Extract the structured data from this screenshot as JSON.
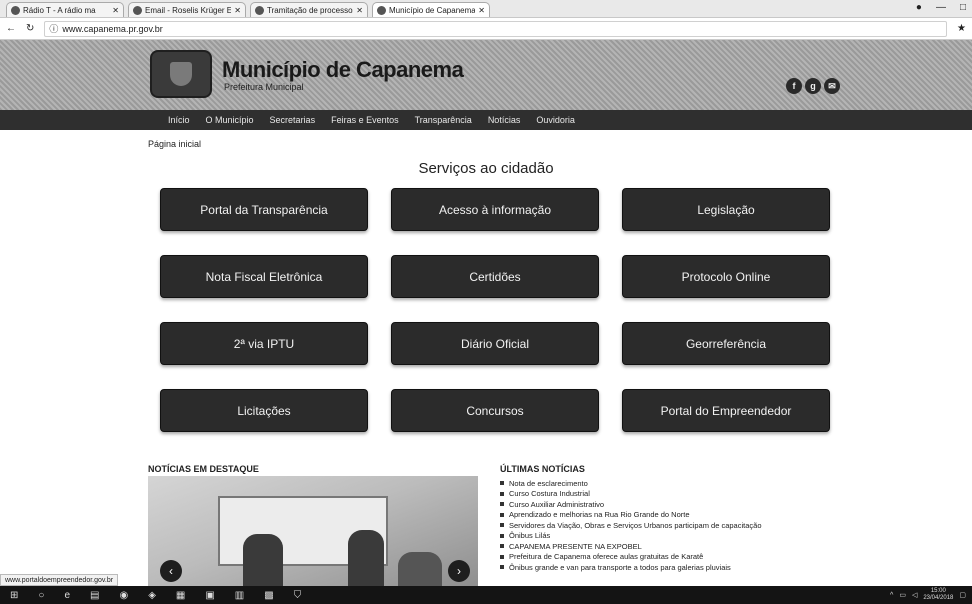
{
  "browser": {
    "tabs": [
      {
        "title": "Rádio T - A rádio ma",
        "active": false
      },
      {
        "title": "Email - Roselis Krüger Ek",
        "active": false
      },
      {
        "title": "Tramitação de processos",
        "active": false
      },
      {
        "title": "Município de Capanema",
        "active": true
      }
    ],
    "url": "www.capanema.pr.gov.br"
  },
  "site": {
    "title": "Município de Capanema",
    "subtitle": "Prefeitura Municipal",
    "nav": [
      "Início",
      "O Município",
      "Secretarias",
      "Feiras e Eventos",
      "Transparência",
      "Notícias",
      "Ouvidoria"
    ],
    "breadcrumb": "Página inicial",
    "services_title": "Serviços ao cidadão",
    "services": [
      "Portal da Transparência",
      "Acesso à informação",
      "Legislação",
      "Nota Fiscal Eletrônica",
      "Certidões",
      "Protocolo Online",
      "2ª via IPTU",
      "Diário Oficial",
      "Georreferência",
      "Licitações",
      "Concursos",
      "Portal do Empreendedor"
    ],
    "news_featured_title": "NOTÍCIAS EM DESTAQUE",
    "news_latest_title": "ÚLTIMAS NOTÍCIAS",
    "news_latest": [
      "Nota de esclarecimento",
      "Curso Costura Industrial",
      "Curso Auxiliar Administrativo",
      "Aprendizado e melhorias na Rua Rio Grande do Norte",
      "Servidores da Viação, Obras e Serviços Urbanos participam de capacitação",
      "Ônibus Lilás",
      "CAPANEMA PRESENTE NA EXPOBEL",
      "Prefeitura de Capanema oferece aulas gratuitas de Karatê",
      "Ônibus grande e van para transporte a todos para galerias pluviais"
    ]
  },
  "status_url": "www.portaldoempreendedor.gov.br",
  "taskbar": {
    "time": "15:00",
    "date": "23/04/2018"
  }
}
